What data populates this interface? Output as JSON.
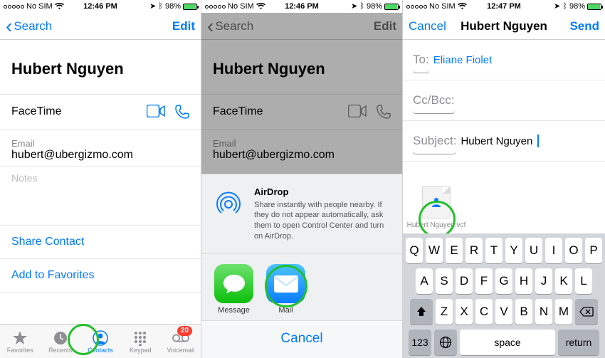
{
  "colors": {
    "tint": "#007aff",
    "green": "#4cd964",
    "highlight": "#22c02a",
    "red": "#ff3b30"
  },
  "status": {
    "carrier": "No SIM",
    "wifi": true,
    "time_a": "12:46 PM",
    "time_b": "12:46 PM",
    "time_c": "12:47 PM",
    "pct": "98%"
  },
  "s1": {
    "back": "Search",
    "edit": "Edit",
    "name": "Hubert Nguyen",
    "facetime": "FaceTime",
    "email_label": "Email",
    "email": "hubert@ubergizmo.com",
    "notes": "Notes",
    "share": "Share Contact",
    "fav": "Add to Favorites",
    "tabs": {
      "favorites": "Favorites",
      "recents": "Recents",
      "contacts": "Contacts",
      "keypad": "Keypad",
      "voicemail": "Voicemail",
      "badge": "20"
    }
  },
  "s2": {
    "airdrop_title": "AirDrop",
    "airdrop_desc": "Share instantly with people nearby. If they do not appear automatically, ask them to open Control Center and turn on AirDrop.",
    "message": "Message",
    "mail": "Mail",
    "cancel": "Cancel"
  },
  "s3": {
    "cancel": "Cancel",
    "title": "Hubert Nguyen",
    "send": "Send",
    "to_label": "To:",
    "to_value": "Eliane Fiolet",
    "cc_label": "Cc/Bcc:",
    "subject_label": "Subject:",
    "subject_value": "Hubert Nguyen",
    "attachment": "Hubert Nguyen.vcf"
  },
  "kb": {
    "r1": [
      "Q",
      "W",
      "E",
      "R",
      "T",
      "Y",
      "U",
      "I",
      "O",
      "P"
    ],
    "r2": [
      "A",
      "S",
      "D",
      "F",
      "G",
      "H",
      "J",
      "K",
      "L"
    ],
    "r3": [
      "Z",
      "X",
      "C",
      "V",
      "B",
      "N",
      "M"
    ],
    "num": "123",
    "space": "space",
    "return": "return"
  }
}
